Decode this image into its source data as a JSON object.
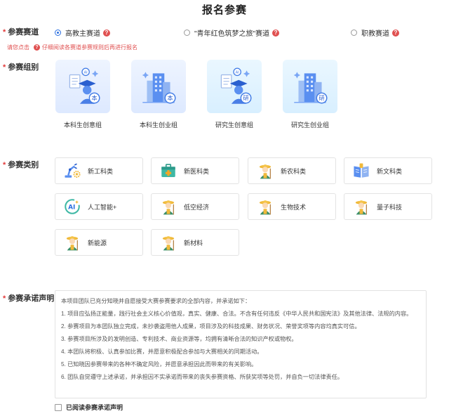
{
  "page": {
    "title": "报名参赛"
  },
  "track": {
    "label": "参赛赛道",
    "options": [
      {
        "label": "高教主赛道",
        "selected": true
      },
      {
        "label": "\"青年红色筑梦之旅\"赛道",
        "selected": false
      },
      {
        "label": "职教赛道",
        "selected": false
      }
    ],
    "notice_prefix": "请您点击",
    "notice_suffix": "仔细阅读各赛道参赛规则后再进行报名"
  },
  "groups": {
    "label": "参赛组别",
    "items": [
      {
        "label": "本科生创意组",
        "badge": "本",
        "icon": "graduate-person-icon"
      },
      {
        "label": "本科生创业组",
        "badge": "本",
        "icon": "buildings-icon"
      },
      {
        "label": "研究生创意组",
        "badge": "研",
        "icon": "graduate-person-icon"
      },
      {
        "label": "研究生创业组",
        "badge": "研",
        "icon": "buildings-icon"
      }
    ]
  },
  "categories": {
    "label": "参赛类别",
    "items": [
      {
        "label": "新工科类",
        "icon": "robot-arm-gear-icon"
      },
      {
        "label": "新医科类",
        "icon": "medical-kit-icon"
      },
      {
        "label": "新农科类",
        "icon": "farmer-icon"
      },
      {
        "label": "新文科类",
        "icon": "open-book-icon"
      },
      {
        "label": "人工智能+",
        "icon": "ai-icon"
      },
      {
        "label": "低空经济",
        "icon": "farmer-icon"
      },
      {
        "label": "生物技术",
        "icon": "farmer-icon"
      },
      {
        "label": "量子科技",
        "icon": "farmer-icon"
      },
      {
        "label": "新能源",
        "icon": "farmer-icon"
      },
      {
        "label": "新材料",
        "icon": "farmer-icon"
      }
    ]
  },
  "declaration": {
    "label": "参赛承诺声明",
    "lines": [
      "本项目团队已充分知晓并自愿接受大赛参赛要求的全部内容，并承诺如下：",
      "1. 项目应弘扬正能量，践行社会主义核心价值观，真实、健康、合法。不含有任何违反《中华人民共和国宪法》及其他法律、法规的内容。",
      "2. 参赛项目为本团队独立完成，未抄袭盗用他人成果，项目涉及的科技成果、财务状况、荣誉奖项等内容均真实可信。",
      "3. 参赛项目所涉及的发明创造、专利技术、商业资源等，均拥有清晰合法的知识产权或物权。",
      "4. 本团队将积极、认真参加比赛，并愿意积极配合参加与大赛相关的同期活动。",
      "5. 已知晓因参赛带来的各种不确定风险，并愿意承担因此而带来的有关影响。",
      "6. 团队自觉遵守上述承诺，并承担因不实承诺而带来的丧失参赛资格、所获奖项等处罚，并自负一切法律责任。"
    ],
    "agree_label": "已阅读参赛承诺声明"
  },
  "colors": {
    "primary": "#2b6fe0",
    "required": "#e23b3b",
    "help": "#e05050"
  }
}
